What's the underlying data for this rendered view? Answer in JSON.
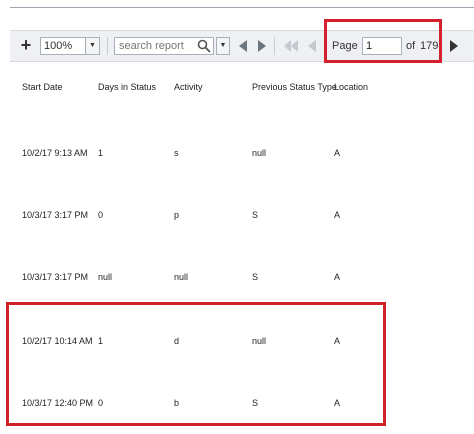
{
  "toolbar": {
    "zoom": "100%",
    "search_placeholder": "search report",
    "page_label": "Page",
    "page_value": "1",
    "of_label": "of",
    "total_pages": "179"
  },
  "table": {
    "headers": [
      "Start Date",
      "Days in Status",
      "Activity",
      "Previous Status Type",
      "Location"
    ],
    "rows": [
      [
        "10/2/17 9:13 AM",
        "1",
        "s",
        "null",
        "A"
      ],
      [
        "10/3/17 3:17 PM",
        "0",
        "p",
        "S",
        "A"
      ],
      [
        "10/3/17 3:17 PM",
        "null",
        "null",
        "S",
        "A"
      ],
      [
        "10/2/17 10:14 AM",
        "1",
        "d",
        "null",
        "A"
      ],
      [
        "10/3/17 12:40 PM",
        "0",
        "b",
        "S",
        "A"
      ]
    ]
  },
  "colors": {
    "highlight": "#d4202c",
    "toolbar_bg": "#eef0f3"
  },
  "icons": [
    "add-icon",
    "search-icon",
    "chevron-down-icon",
    "previous-icon",
    "next-icon",
    "first-page-icon"
  ]
}
